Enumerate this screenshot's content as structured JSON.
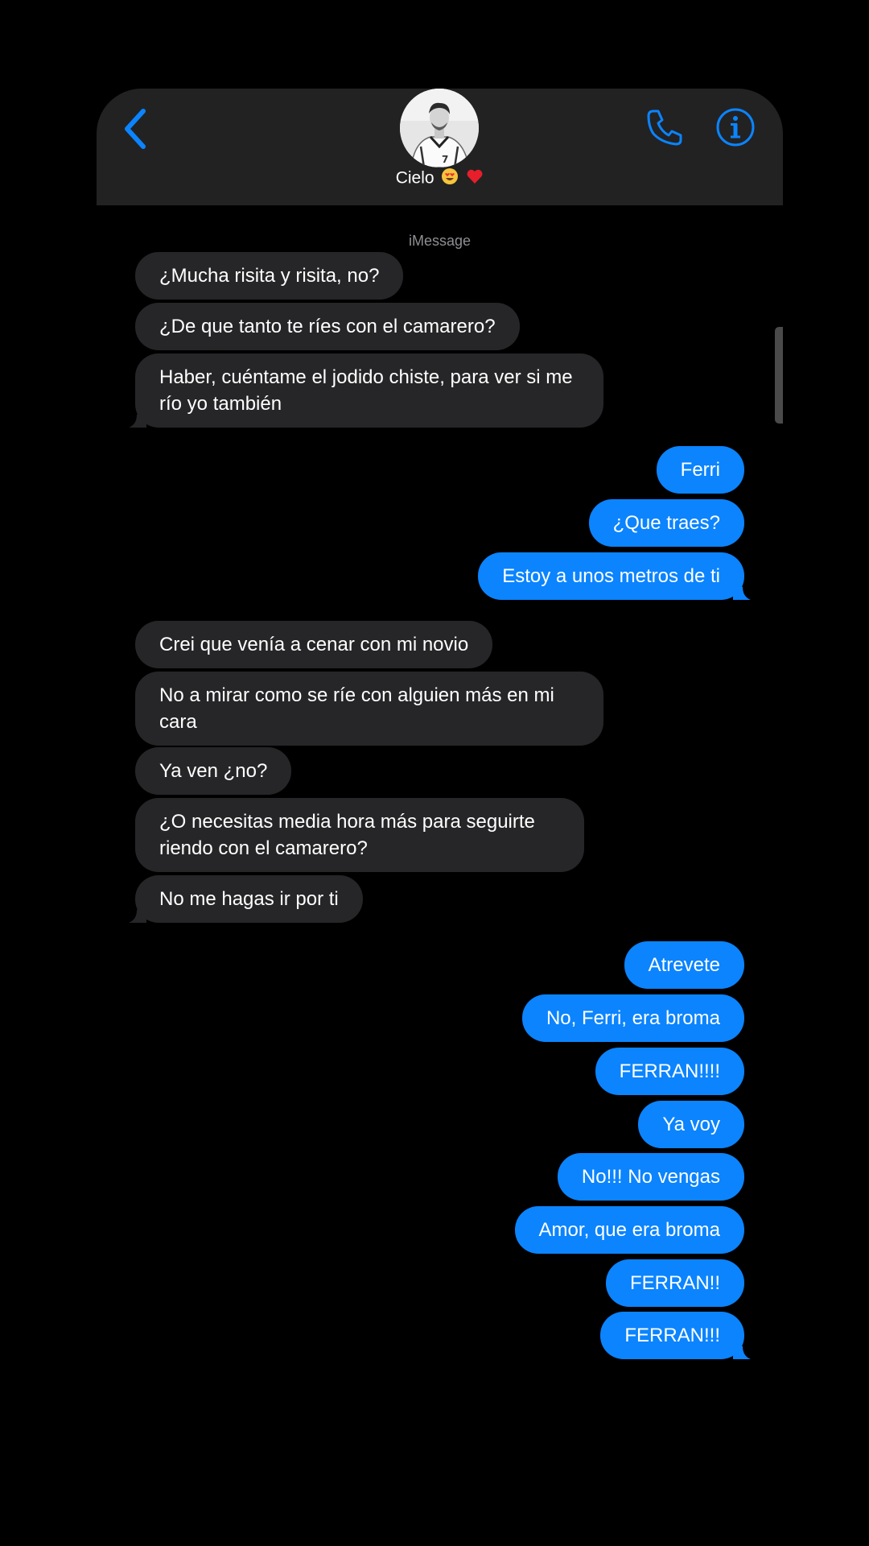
{
  "header": {
    "contact_name": "Cielo",
    "contact_emojis": [
      "heart-eyes-emoji",
      "red-heart-emoji"
    ],
    "back_icon": "chevron-left-icon",
    "call_icon": "phone-icon",
    "info_icon": "info-icon",
    "accent_color": "#0b84fe"
  },
  "conversation": {
    "service_label": "iMessage",
    "incoming_color": "#262628",
    "outgoing_color": "#0b84fe",
    "messages": [
      {
        "side": "in",
        "text": "¿Mucha risita y risita, no?"
      },
      {
        "side": "in",
        "text": "¿De que tanto te ríes con el camarero?"
      },
      {
        "side": "in",
        "text": "Haber, cuéntame el jodido chiste, para ver si me río yo también"
      },
      {
        "side": "out",
        "text": "Ferri"
      },
      {
        "side": "out",
        "text": "¿Que traes?"
      },
      {
        "side": "out",
        "text": "Estoy a unos metros de ti"
      },
      {
        "side": "in",
        "text": "Crei que venía a cenar con mi novio"
      },
      {
        "side": "in",
        "text": "No a mirar como se ríe con alguien más en mi cara"
      },
      {
        "side": "in",
        "text": "Ya ven ¿no?"
      },
      {
        "side": "in",
        "text": "¿O necesitas media hora más para seguirte riendo con el camarero?"
      },
      {
        "side": "in",
        "text": "No me hagas ir por ti"
      },
      {
        "side": "out",
        "text": "Atrevete"
      },
      {
        "side": "out",
        "text": "No, Ferri, era broma"
      },
      {
        "side": "out",
        "text": "FERRAN!!!!"
      },
      {
        "side": "out",
        "text": "Ya voy"
      },
      {
        "side": "out",
        "text": "No!!! No vengas"
      },
      {
        "side": "out",
        "text": "Amor, que era broma"
      },
      {
        "side": "out",
        "text": "FERRAN!!"
      },
      {
        "side": "out",
        "text": "FERRAN!!!"
      }
    ]
  }
}
